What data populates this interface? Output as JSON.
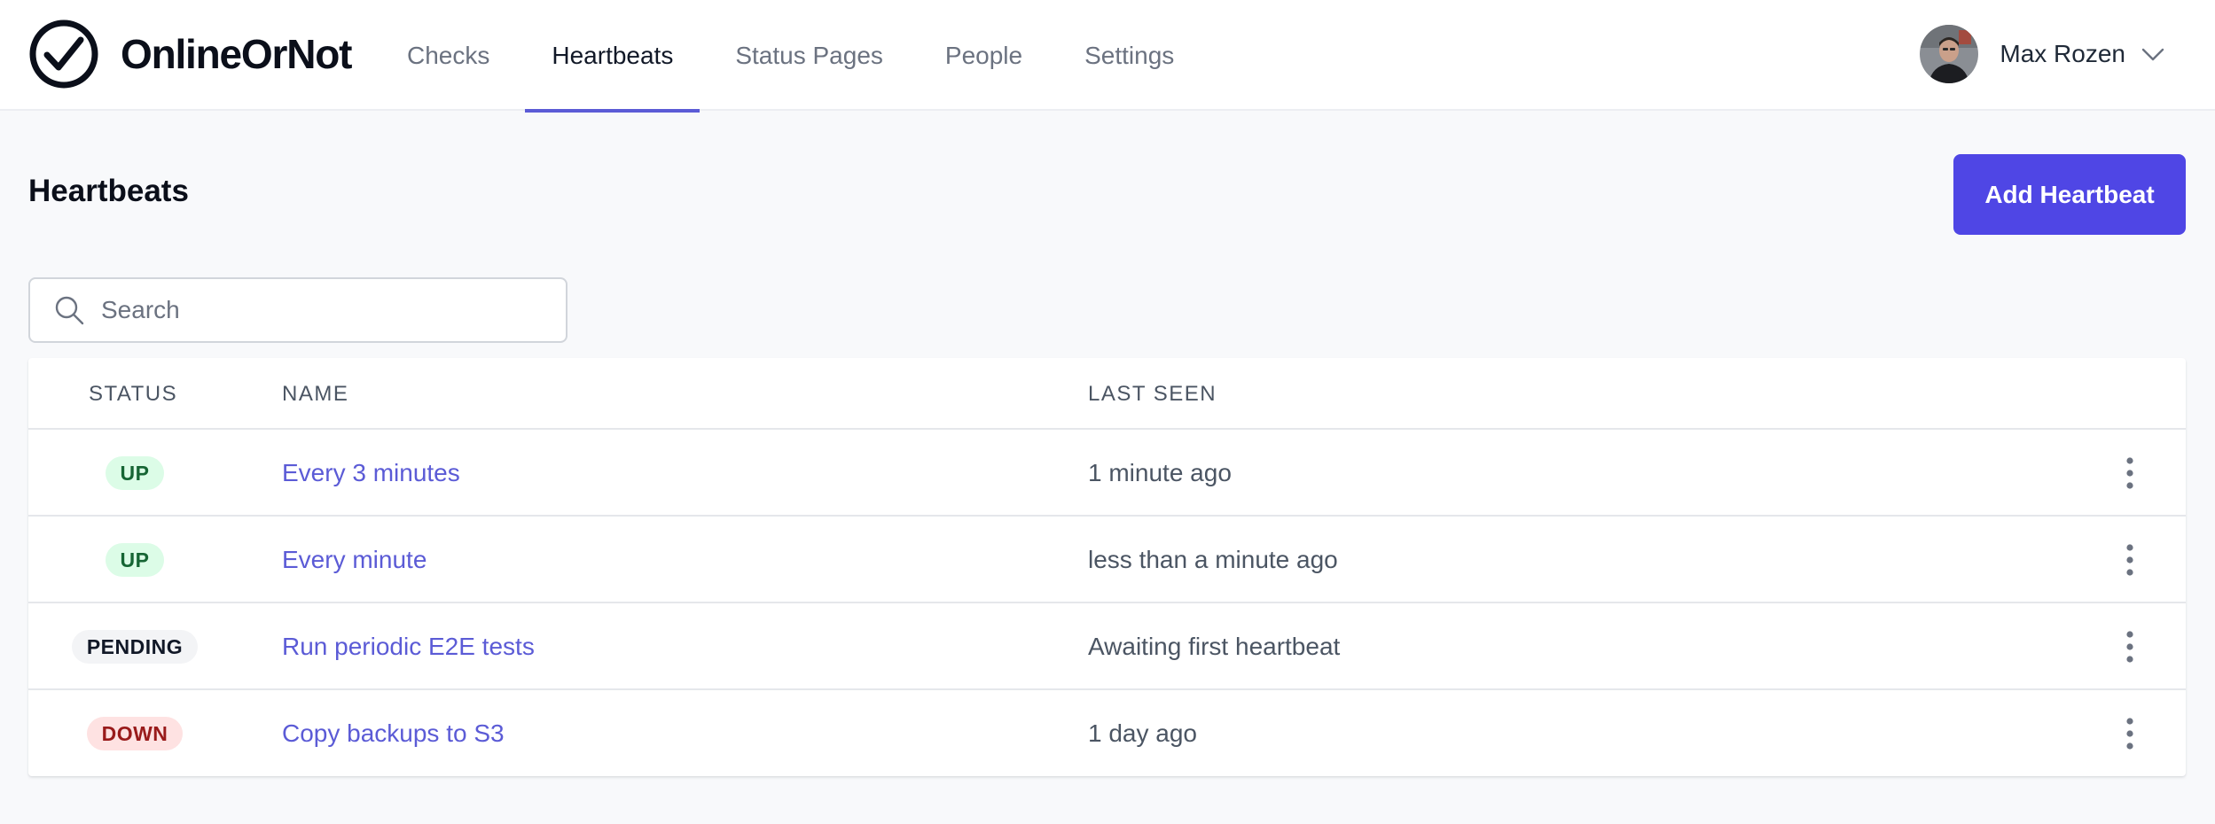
{
  "brand": {
    "name": "OnlineOrNot"
  },
  "nav": {
    "items": [
      {
        "label": "Checks"
      },
      {
        "label": "Heartbeats"
      },
      {
        "label": "Status Pages"
      },
      {
        "label": "People"
      },
      {
        "label": "Settings"
      }
    ],
    "active": "Heartbeats"
  },
  "user": {
    "name": "Max Rozen"
  },
  "page": {
    "title": "Heartbeats",
    "add_button_label": "Add Heartbeat"
  },
  "search": {
    "placeholder": "Search",
    "value": ""
  },
  "table": {
    "columns": [
      "STATUS",
      "NAME",
      "LAST SEEN"
    ],
    "rows": [
      {
        "status": "UP",
        "name": "Every 3 minutes",
        "last_seen": "1 minute ago"
      },
      {
        "status": "UP",
        "name": "Every minute",
        "last_seen": "less than a minute ago"
      },
      {
        "status": "PENDING",
        "name": "Run periodic E2E tests",
        "last_seen": "Awaiting first heartbeat"
      },
      {
        "status": "DOWN",
        "name": "Copy backups to S3",
        "last_seen": "1 day ago"
      }
    ]
  },
  "colors": {
    "accent": "#4f46e5",
    "link": "#5b5bd6",
    "status_up_bg": "#dcfce7",
    "status_up_text": "#166534",
    "status_pending_bg": "#f3f4f6",
    "status_down_bg": "#fee2e2",
    "status_down_text": "#991b1b"
  },
  "icons": {
    "logo": "check-circle-icon",
    "search": "search-icon",
    "user_menu": "chevron-down-icon",
    "row_menu": "more-vertical-icon"
  }
}
